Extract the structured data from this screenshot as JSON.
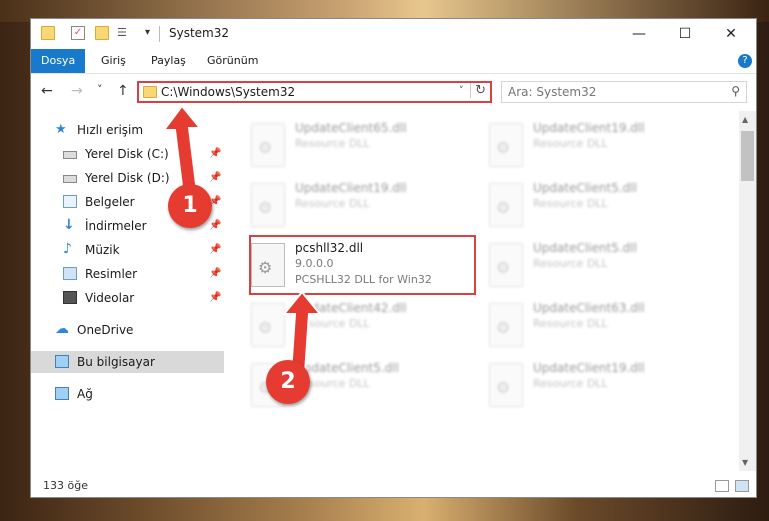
{
  "window": {
    "title": "System32",
    "minimize_glyph": "—",
    "maximize_glyph": "☐",
    "close_glyph": "✕"
  },
  "ribbon": {
    "tabs": [
      {
        "label": "Dosya",
        "active": true
      },
      {
        "label": "Giriş",
        "active": false
      },
      {
        "label": "Paylaş",
        "active": false
      },
      {
        "label": "Görünüm",
        "active": false
      }
    ],
    "help_glyph": "?"
  },
  "nav": {
    "back": "←",
    "forward": "→",
    "recent": "˅",
    "up": "↑"
  },
  "address": {
    "path": "C:\\Windows\\System32",
    "dropdown": "˅",
    "refresh": "↻"
  },
  "search": {
    "placeholder": "Ara: System32",
    "icon": "search-icon"
  },
  "sidebar": {
    "items": [
      {
        "label": "Hızlı erişim",
        "icon": "star-icon",
        "pinned": false
      },
      {
        "label": "Yerel Disk (C:)",
        "icon": "drive-icon",
        "pinned": true
      },
      {
        "label": "Yerel Disk (D:)",
        "icon": "drive-icon",
        "pinned": true
      },
      {
        "label": "Belgeler",
        "icon": "documents-icon",
        "pinned": true
      },
      {
        "label": "İndirmeler",
        "icon": "download-icon",
        "pinned": true
      },
      {
        "label": "Müzik",
        "icon": "music-icon",
        "pinned": true
      },
      {
        "label": "Resimler",
        "icon": "pictures-icon",
        "pinned": true
      },
      {
        "label": "Videolar",
        "icon": "video-icon",
        "pinned": true
      },
      {
        "label": "OneDrive",
        "icon": "cloud-icon",
        "pinned": false
      },
      {
        "label": "Bu bilgisayar",
        "icon": "computer-icon",
        "pinned": false,
        "selected": true
      },
      {
        "label": "Ağ",
        "icon": "network-icon",
        "pinned": false
      }
    ],
    "pin_glyph": "📌"
  },
  "files": {
    "left": [
      {
        "name": "UpdateClient65.dll",
        "desc": "Resource DLL"
      },
      {
        "name": "UpdateClient19.dll",
        "desc": "Resource DLL"
      },
      {
        "name": "pcshll32.dll",
        "version": "9.0.0.0",
        "desc": "PCSHLL32 DLL for Win32",
        "highlighted": true
      },
      {
        "name": "UpdateClient42.dll",
        "desc": "Resource DLL"
      },
      {
        "name": "UpdateClient5.dll",
        "desc": "Resource DLL"
      }
    ],
    "right": [
      {
        "name": "UpdateClient19.dll",
        "desc": "Resource DLL"
      },
      {
        "name": "UpdateClient5.dll",
        "desc": "Resource DLL"
      },
      {
        "name": "UpdateClient5.dll",
        "desc": "Resource DLL"
      },
      {
        "name": "UpdateClient63.dll",
        "desc": "Resource DLL"
      },
      {
        "name": "UpdateClient19.dll",
        "desc": "Resource DLL"
      }
    ]
  },
  "status": {
    "count": "133 öğe"
  },
  "annotations": {
    "step1": "1",
    "step2": "2",
    "color": "#e53b30"
  }
}
